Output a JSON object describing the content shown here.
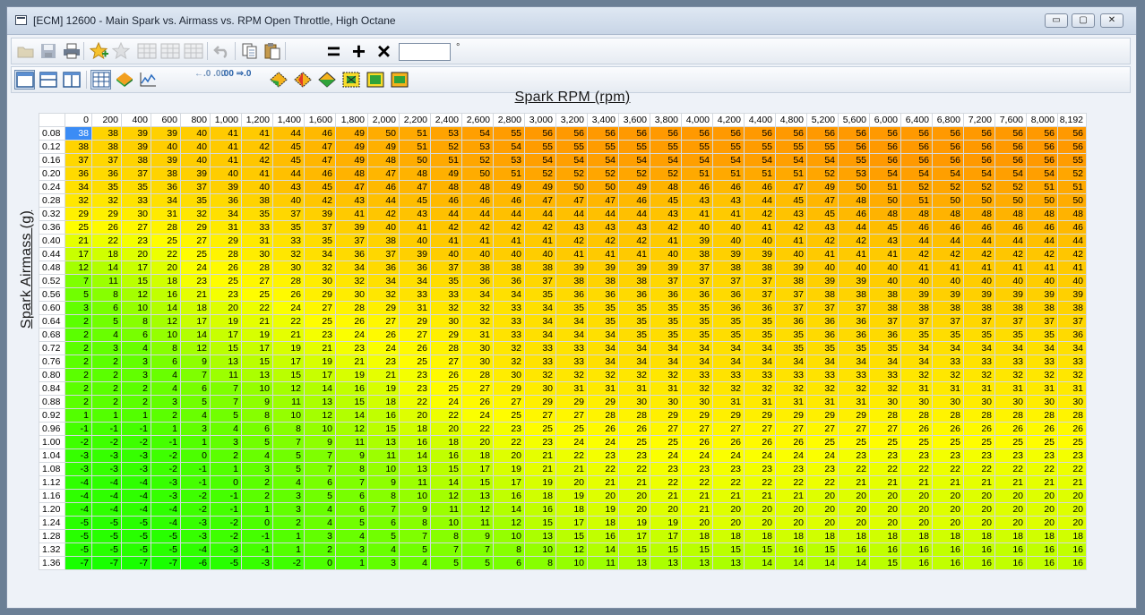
{
  "window": {
    "title": "[ECM] 12600 - Main Spark vs. Airmass vs. RPM Open Throttle, High Octane",
    "controls": {
      "minimize": "▭",
      "maximize": "▢",
      "close": "✕"
    }
  },
  "toolbar": {
    "value_input": "",
    "degree_symbol": "°",
    "format_decrease": "←.0 .00",
    "format_increase": ".00 ⇒.0",
    "equals": "=",
    "plus": "+",
    "multiply": "×"
  },
  "table": {
    "x_axis_label": "Spark RPM (rpm)",
    "y_axis_label": "Spark Airmass (g)",
    "columns": [
      "0",
      "200",
      "400",
      "600",
      "800",
      "1,000",
      "1,200",
      "1,400",
      "1,600",
      "1,800",
      "2,000",
      "2,200",
      "2,400",
      "2,600",
      "2,800",
      "3,000",
      "3,200",
      "3,400",
      "3,600",
      "3,800",
      "4,000",
      "4,200",
      "4,400",
      "4,800",
      "5,200",
      "5,600",
      "6,000",
      "6,400",
      "6,800",
      "7,200",
      "7,600",
      "8,000",
      "8,192"
    ],
    "rows": [
      "0.08",
      "0.12",
      "0.16",
      "0.20",
      "0.24",
      "0.28",
      "0.32",
      "0.36",
      "0.40",
      "0.44",
      "0.48",
      "0.52",
      "0.56",
      "0.60",
      "0.64",
      "0.68",
      "0.72",
      "0.76",
      "0.80",
      "0.84",
      "0.88",
      "0.92",
      "0.96",
      "1.00",
      "1.04",
      "1.08",
      "1.12",
      "1.16",
      "1.20",
      "1.24",
      "1.28",
      "1.32",
      "1.36"
    ],
    "values": [
      [
        38,
        38,
        39,
        39,
        40,
        41,
        41,
        44,
        46,
        49,
        50,
        51,
        53,
        54,
        55,
        56,
        56,
        56,
        56,
        56,
        56,
        56,
        56,
        56,
        56,
        56,
        56,
        56,
        56,
        56,
        56,
        56,
        56
      ],
      [
        38,
        38,
        39,
        40,
        40,
        41,
        42,
        45,
        47,
        49,
        49,
        51,
        52,
        53,
        54,
        55,
        55,
        55,
        55,
        55,
        55,
        55,
        55,
        55,
        55,
        56,
        56,
        56,
        56,
        56,
        56,
        56,
        56
      ],
      [
        37,
        37,
        38,
        39,
        40,
        41,
        42,
        45,
        47,
        49,
        48,
        50,
        51,
        52,
        53,
        54,
        54,
        54,
        54,
        54,
        54,
        54,
        54,
        54,
        54,
        55,
        56,
        56,
        56,
        56,
        56,
        56,
        55
      ],
      [
        36,
        36,
        37,
        38,
        39,
        40,
        41,
        44,
        46,
        48,
        47,
        48,
        49,
        50,
        51,
        52,
        52,
        52,
        52,
        52,
        51,
        51,
        51,
        51,
        52,
        53,
        54,
        54,
        54,
        54,
        54,
        54,
        52
      ],
      [
        34,
        35,
        35,
        36,
        37,
        39,
        40,
        43,
        45,
        47,
        46,
        47,
        48,
        48,
        49,
        49,
        50,
        50,
        49,
        48,
        46,
        46,
        46,
        47,
        49,
        50,
        51,
        52,
        52,
        52,
        52,
        51,
        51
      ],
      [
        32,
        32,
        33,
        34,
        35,
        36,
        38,
        40,
        42,
        43,
        44,
        45,
        46,
        46,
        46,
        47,
        47,
        47,
        46,
        45,
        43,
        43,
        44,
        45,
        47,
        48,
        50,
        51,
        50,
        50,
        50,
        50,
        50
      ],
      [
        29,
        29,
        30,
        31,
        32,
        34,
        35,
        37,
        39,
        41,
        42,
        43,
        44,
        44,
        44,
        44,
        44,
        44,
        44,
        43,
        41,
        41,
        42,
        43,
        45,
        46,
        48,
        48,
        48,
        48,
        48,
        48,
        48
      ],
      [
        25,
        26,
        27,
        28,
        29,
        31,
        33,
        35,
        37,
        39,
        40,
        41,
        42,
        42,
        42,
        42,
        43,
        43,
        43,
        42,
        40,
        40,
        41,
        42,
        43,
        44,
        45,
        46,
        46,
        46,
        46,
        46,
        46
      ],
      [
        21,
        22,
        23,
        25,
        27,
        29,
        31,
        33,
        35,
        37,
        38,
        40,
        41,
        41,
        41,
        41,
        42,
        42,
        42,
        41,
        39,
        40,
        40,
        41,
        42,
        42,
        43,
        44,
        44,
        44,
        44,
        44,
        44
      ],
      [
        17,
        18,
        20,
        22,
        25,
        28,
        30,
        32,
        34,
        36,
        37,
        39,
        40,
        40,
        40,
        40,
        41,
        41,
        41,
        40,
        38,
        39,
        39,
        40,
        41,
        41,
        41,
        42,
        42,
        42,
        42,
        42,
        42
      ],
      [
        12,
        14,
        17,
        20,
        24,
        26,
        28,
        30,
        32,
        34,
        36,
        36,
        37,
        38,
        38,
        38,
        39,
        39,
        39,
        39,
        37,
        38,
        38,
        39,
        40,
        40,
        40,
        41,
        41,
        41,
        41,
        41,
        41
      ],
      [
        7,
        11,
        15,
        18,
        23,
        25,
        27,
        28,
        30,
        32,
        34,
        34,
        35,
        36,
        36,
        37,
        38,
        38,
        38,
        37,
        37,
        37,
        37,
        38,
        39,
        39,
        40,
        40,
        40,
        40,
        40,
        40,
        40
      ],
      [
        5,
        8,
        12,
        16,
        21,
        23,
        25,
        26,
        29,
        30,
        32,
        33,
        33,
        34,
        34,
        35,
        36,
        36,
        36,
        36,
        36,
        36,
        37,
        37,
        38,
        38,
        38,
        39,
        39,
        39,
        39,
        39,
        39
      ],
      [
        3,
        6,
        10,
        14,
        18,
        20,
        22,
        24,
        27,
        28,
        29,
        31,
        32,
        32,
        33,
        34,
        35,
        35,
        35,
        35,
        35,
        36,
        36,
        37,
        37,
        37,
        38,
        38,
        38,
        38,
        38,
        38,
        38
      ],
      [
        2,
        5,
        8,
        12,
        17,
        19,
        21,
        22,
        25,
        26,
        27,
        29,
        30,
        32,
        33,
        34,
        34,
        35,
        35,
        35,
        35,
        35,
        35,
        36,
        36,
        36,
        37,
        37,
        37,
        37,
        37,
        37,
        37
      ],
      [
        2,
        4,
        6,
        10,
        14,
        17,
        19,
        21,
        23,
        24,
        26,
        27,
        29,
        31,
        33,
        34,
        34,
        34,
        35,
        35,
        35,
        35,
        35,
        35,
        36,
        36,
        36,
        35,
        35,
        35,
        35,
        35,
        36
      ],
      [
        2,
        3,
        4,
        8,
        12,
        15,
        17,
        19,
        21,
        23,
        24,
        26,
        28,
        30,
        32,
        33,
        33,
        34,
        34,
        34,
        34,
        34,
        34,
        35,
        35,
        35,
        35,
        34,
        34,
        34,
        34,
        34,
        34
      ],
      [
        2,
        2,
        3,
        6,
        9,
        13,
        15,
        17,
        19,
        21,
        23,
        25,
        27,
        30,
        32,
        33,
        33,
        34,
        34,
        34,
        34,
        34,
        34,
        34,
        34,
        34,
        34,
        34,
        33,
        33,
        33,
        33,
        33
      ],
      [
        2,
        2,
        3,
        4,
        7,
        11,
        13,
        15,
        17,
        19,
        21,
        23,
        26,
        28,
        30,
        32,
        32,
        32,
        32,
        32,
        33,
        33,
        33,
        33,
        33,
        33,
        33,
        32,
        32,
        32,
        32,
        32,
        32
      ],
      [
        2,
        2,
        2,
        4,
        6,
        7,
        10,
        12,
        14,
        16,
        19,
        23,
        25,
        27,
        29,
        30,
        31,
        31,
        31,
        31,
        32,
        32,
        32,
        32,
        32,
        32,
        32,
        31,
        31,
        31,
        31,
        31,
        31
      ],
      [
        2,
        2,
        2,
        3,
        5,
        7,
        9,
        11,
        13,
        15,
        18,
        22,
        24,
        26,
        27,
        29,
        29,
        29,
        30,
        30,
        30,
        31,
        31,
        31,
        31,
        31,
        30,
        30,
        30,
        30,
        30,
        30,
        30
      ],
      [
        1,
        1,
        1,
        2,
        4,
        5,
        8,
        10,
        12,
        14,
        16,
        20,
        22,
        24,
        25,
        27,
        27,
        28,
        28,
        29,
        29,
        29,
        29,
        29,
        29,
        29,
        28,
        28,
        28,
        28,
        28,
        28,
        28
      ],
      [
        -1,
        -1,
        -1,
        1,
        3,
        4,
        6,
        8,
        10,
        12,
        15,
        18,
        20,
        22,
        23,
        25,
        25,
        26,
        26,
        27,
        27,
        27,
        27,
        27,
        27,
        27,
        27,
        26,
        26,
        26,
        26,
        26,
        26
      ],
      [
        -2,
        -2,
        -2,
        -1,
        1,
        3,
        5,
        7,
        9,
        11,
        13,
        16,
        18,
        20,
        22,
        23,
        24,
        24,
        25,
        25,
        26,
        26,
        26,
        26,
        25,
        25,
        25,
        25,
        25,
        25,
        25,
        25,
        25
      ],
      [
        -3,
        -3,
        -3,
        -2,
        0,
        2,
        4,
        5,
        7,
        9,
        11,
        14,
        16,
        18,
        20,
        21,
        22,
        23,
        23,
        24,
        24,
        24,
        24,
        24,
        24,
        23,
        23,
        23,
        23,
        23,
        23,
        23,
        23
      ],
      [
        -3,
        -3,
        -3,
        -2,
        -1,
        1,
        3,
        5,
        7,
        8,
        10,
        13,
        15,
        17,
        19,
        21,
        21,
        22,
        22,
        23,
        23,
        23,
        23,
        23,
        23,
        22,
        22,
        22,
        22,
        22,
        22,
        22,
        22
      ],
      [
        -4,
        -4,
        -4,
        -3,
        -1,
        0,
        2,
        4,
        6,
        7,
        9,
        11,
        14,
        15,
        17,
        19,
        20,
        21,
        21,
        22,
        22,
        22,
        22,
        22,
        22,
        21,
        21,
        21,
        21,
        21,
        21,
        21,
        21
      ],
      [
        -4,
        -4,
        -4,
        -3,
        -2,
        -1,
        2,
        3,
        5,
        6,
        8,
        10,
        12,
        13,
        16,
        18,
        19,
        20,
        20,
        21,
        21,
        21,
        21,
        21,
        20,
        20,
        20,
        20,
        20,
        20,
        20,
        20,
        20
      ],
      [
        -4,
        -4,
        -4,
        -4,
        -2,
        -1,
        1,
        3,
        4,
        6,
        7,
        9,
        11,
        12,
        14,
        16,
        18,
        19,
        20,
        20,
        21,
        20,
        20,
        20,
        20,
        20,
        20,
        20,
        20,
        20,
        20,
        20,
        20
      ],
      [
        -5,
        -5,
        -5,
        -4,
        -3,
        -2,
        0,
        2,
        4,
        5,
        6,
        8,
        10,
        11,
        12,
        15,
        17,
        18,
        19,
        19,
        20,
        20,
        20,
        20,
        20,
        20,
        20,
        20,
        20,
        20,
        20,
        20,
        20
      ],
      [
        -5,
        -5,
        -5,
        -5,
        -3,
        -2,
        -1,
        1,
        3,
        4,
        5,
        7,
        8,
        9,
        10,
        13,
        15,
        16,
        17,
        17,
        18,
        18,
        18,
        18,
        18,
        18,
        18,
        18,
        18,
        18,
        18,
        18,
        18
      ],
      [
        -5,
        -5,
        -5,
        -5,
        -4,
        -3,
        -1,
        1,
        2,
        3,
        4,
        5,
        7,
        7,
        8,
        10,
        12,
        14,
        15,
        15,
        15,
        15,
        15,
        16,
        15,
        16,
        16,
        16,
        16,
        16,
        16,
        16,
        16
      ],
      [
        -7,
        -7,
        -7,
        -7,
        -6,
        -5,
        -3,
        -2,
        0,
        1,
        3,
        4,
        5,
        5,
        6,
        8,
        10,
        11,
        13,
        13,
        13,
        13,
        14,
        14,
        14,
        14,
        15,
        16,
        16,
        16,
        16,
        16,
        16
      ]
    ],
    "selected_cell": {
      "row": 0,
      "col": 0
    },
    "color_scale": {
      "low": "#19ff00",
      "mid": "#ffff00",
      "high": "#ff9900"
    }
  }
}
